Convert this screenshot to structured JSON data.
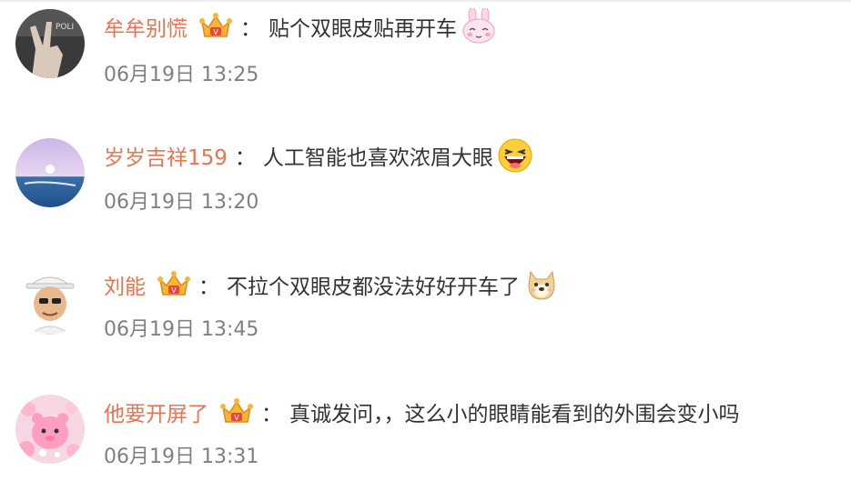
{
  "comments": [
    {
      "username": "牟牟别慌",
      "has_badge": true,
      "colon": "：",
      "text": "贴个双眼皮贴再开车",
      "emoji": "bunny-shy-emoji",
      "timestamp": "06月19日 13:25",
      "avatar": "hand-gesture-avatar"
    },
    {
      "username": "岁岁吉祥159",
      "has_badge": false,
      "colon": "：",
      "text": "人工智能也喜欢浓眉大眼",
      "emoji": "laughing-face-emoji",
      "timestamp": "06月19日 13:20",
      "avatar": "sea-sunset-avatar"
    },
    {
      "username": "刘能",
      "has_badge": true,
      "colon": "：",
      "text": "不拉个双眼皮都没法好好开车了",
      "emoji": "doge-emoji",
      "timestamp": "06月19日 13:45",
      "avatar": "cartoon-man-avatar"
    },
    {
      "username": "他要开屏了",
      "has_badge": true,
      "colon": "：",
      "text": "真诚发问，，这么小的眼睛能看到的外围会变小吗",
      "emoji": "",
      "timestamp": "06月19日 13:31",
      "avatar": "pink-plush-avatar"
    }
  ],
  "colors": {
    "username": "#eb7350",
    "text": "#333333",
    "timestamp": "#808080",
    "badge_gold": "#f5a623"
  }
}
